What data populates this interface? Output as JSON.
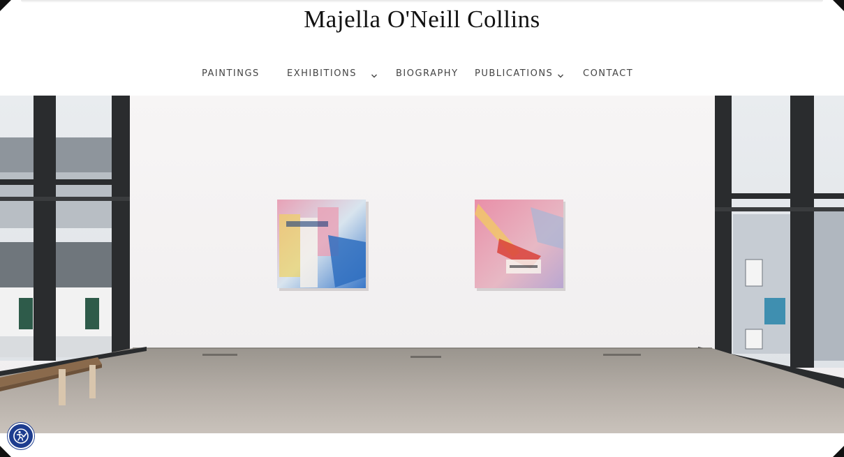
{
  "site": {
    "title": "Majella O'Neill Collins"
  },
  "nav": {
    "items": [
      {
        "label": "PAINTINGS",
        "has_dropdown": false
      },
      {
        "label": "EXHIBITIONS",
        "has_dropdown": true
      },
      {
        "label": "BIOGRAPHY",
        "has_dropdown": false
      },
      {
        "label": "PUBLICATIONS",
        "has_dropdown": true
      },
      {
        "label": "CONTACT",
        "has_dropdown": false
      }
    ]
  },
  "hero": {
    "subject": "gallery installation view with two abstract paintings",
    "accent_colors": [
      "#e8a1b6",
      "#f2c7d3",
      "#3a78c9",
      "#d9423a"
    ]
  },
  "accessibility_widget": {
    "icon": "accessibility-icon",
    "color": "#1e3d8f"
  }
}
